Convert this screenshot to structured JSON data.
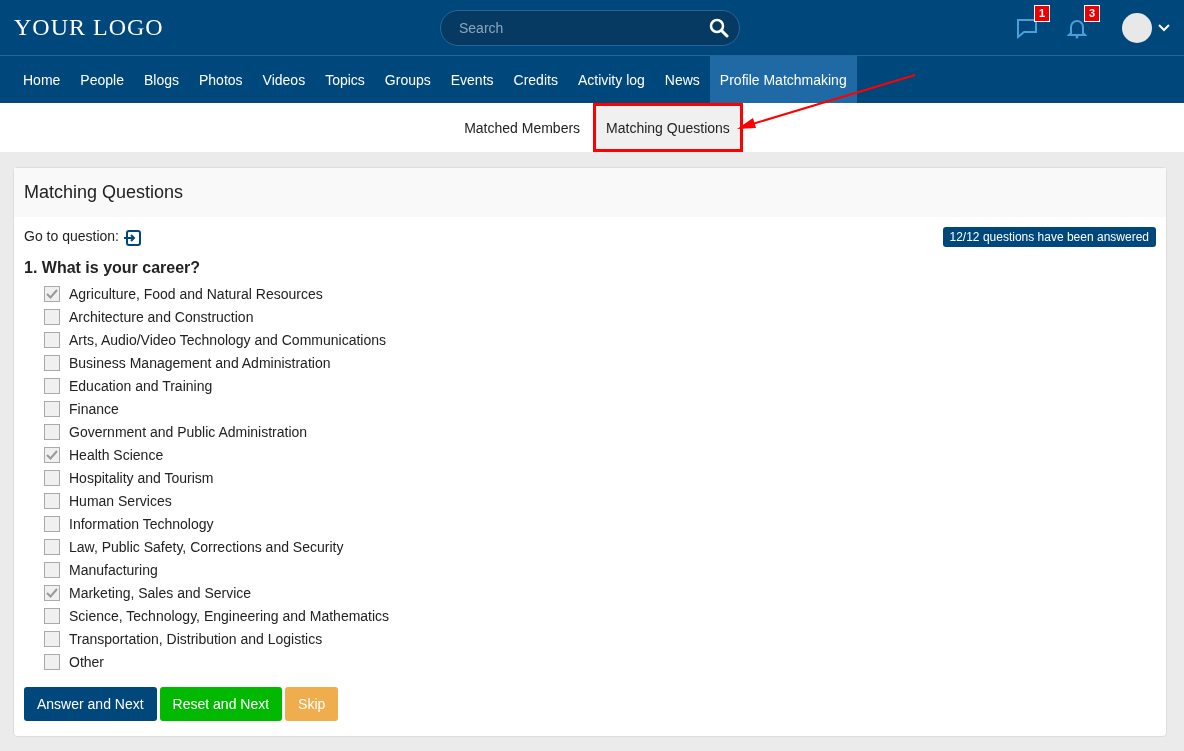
{
  "logo": "YOUR LOGO",
  "search": {
    "placeholder": "Search"
  },
  "header_icons": [
    {
      "kind": "messages",
      "count": "1"
    },
    {
      "kind": "notifications",
      "count": "3"
    }
  ],
  "nav": [
    {
      "label": "Home",
      "selected": false
    },
    {
      "label": "People",
      "selected": false
    },
    {
      "label": "Blogs",
      "selected": false
    },
    {
      "label": "Photos",
      "selected": false
    },
    {
      "label": "Videos",
      "selected": false
    },
    {
      "label": "Topics",
      "selected": false
    },
    {
      "label": "Groups",
      "selected": false
    },
    {
      "label": "Events",
      "selected": false
    },
    {
      "label": "Credits",
      "selected": false
    },
    {
      "label": "Activity log",
      "selected": false
    },
    {
      "label": "News",
      "selected": false
    },
    {
      "label": "Profile Matchmaking",
      "selected": true
    }
  ],
  "subtabs": [
    {
      "label": "Matched Members",
      "selected": false,
      "highlighted": false
    },
    {
      "label": "Matching Questions",
      "selected": true,
      "highlighted": true
    }
  ],
  "card": {
    "title": "Matching Questions",
    "goto_label": "Go to question:",
    "status_badge": "12/12 questions have been answered",
    "question": "1. What is your career?",
    "options": [
      {
        "label": "Agriculture, Food and Natural Resources",
        "checked": true
      },
      {
        "label": "Architecture and Construction",
        "checked": false
      },
      {
        "label": "Arts, Audio/Video Technology and Communications",
        "checked": false
      },
      {
        "label": "Business Management and Administration",
        "checked": false
      },
      {
        "label": "Education and Training",
        "checked": false
      },
      {
        "label": "Finance",
        "checked": false
      },
      {
        "label": "Government and Public Administration",
        "checked": false
      },
      {
        "label": "Health Science",
        "checked": true
      },
      {
        "label": "Hospitality and Tourism",
        "checked": false
      },
      {
        "label": "Human Services",
        "checked": false
      },
      {
        "label": "Information Technology",
        "checked": false
      },
      {
        "label": "Law, Public Safety, Corrections and Security",
        "checked": false
      },
      {
        "label": "Manufacturing",
        "checked": false
      },
      {
        "label": "Marketing, Sales and Service",
        "checked": true
      },
      {
        "label": "Science, Technology, Engineering and Mathematics",
        "checked": false
      },
      {
        "label": "Transportation, Distribution and Logistics",
        "checked": false
      },
      {
        "label": "Other",
        "checked": false
      }
    ],
    "buttons": [
      {
        "label": "Answer and Next",
        "kind": "primary"
      },
      {
        "label": "Reset and Next",
        "kind": "success"
      },
      {
        "label": "Skip",
        "kind": "warning"
      }
    ]
  }
}
